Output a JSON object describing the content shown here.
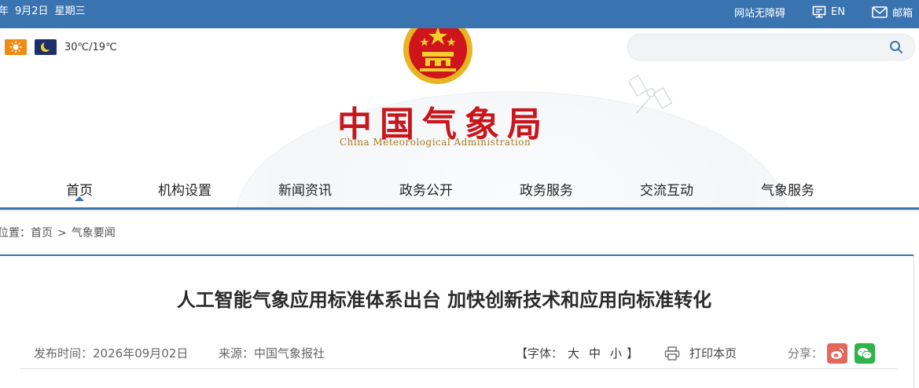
{
  "topbar": {
    "date_year_suffix": "年",
    "date_month_day": "9月2日",
    "weekday": "星期三",
    "accessibility_label": "网站无障碍",
    "english_label": "EN",
    "mail_label": "邮箱",
    "bg_color": "#3a74b0"
  },
  "weather": {
    "day_icon": "sun-icon",
    "night_icon": "moon-icon",
    "temperature": "30℃/19℃"
  },
  "search": {
    "placeholder": "",
    "icon": "search-icon"
  },
  "logo": {
    "name_cn": "中国气象局",
    "name_en": "China Meteorological Administration",
    "emblem": "national-emblem-icon"
  },
  "nav": {
    "items": [
      {
        "label": "首页",
        "active": true
      },
      {
        "label": "机构设置"
      },
      {
        "label": "新闻资讯"
      },
      {
        "label": "政务公开"
      },
      {
        "label": "政务服务"
      },
      {
        "label": "交流互动"
      },
      {
        "label": "气象服务"
      }
    ]
  },
  "breadcrumb": {
    "prefix": "位置：",
    "home": "首页",
    "separator": ">",
    "current": "气象要闻"
  },
  "article": {
    "title": "人工智能气象应用标准体系出台 加快创新技术和应用向标准转化",
    "published_label": "发布时间：",
    "published_date": "2026年09月02日",
    "source_label": "来源：",
    "source": "中国气象报社",
    "font_label_open": "【字体：",
    "font_large": "大",
    "font_medium": "中",
    "font_small": "小",
    "font_label_close": "】",
    "print_label": "打印本页",
    "share_label": "分享：",
    "share_weibo_icon": "weibo-icon",
    "share_wechat_icon": "wechat-icon"
  },
  "colors": {
    "accent": "#3a74b0",
    "brand_red": "#c8161d",
    "brand_gold": "#a8781c"
  }
}
